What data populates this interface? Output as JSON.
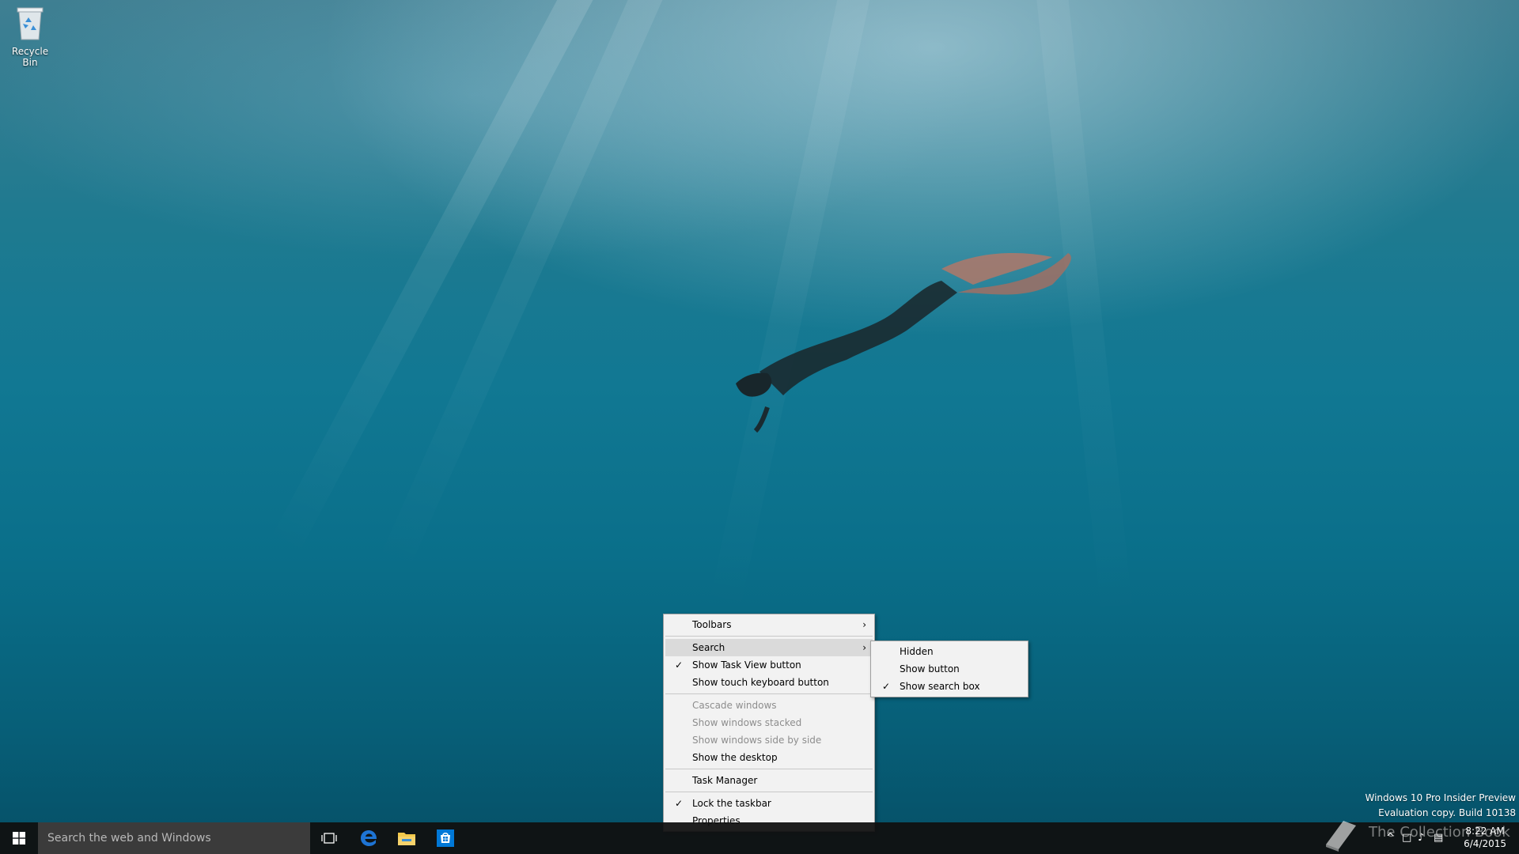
{
  "desktop": {
    "icons": [
      {
        "label": "Recycle Bin",
        "icon": "recycle-bin-icon"
      }
    ]
  },
  "context_menu": {
    "items": [
      {
        "label": "Toolbars",
        "checked": false,
        "submenu": true,
        "disabled": false
      },
      {
        "label": "Search",
        "checked": false,
        "submenu": true,
        "disabled": false,
        "highlighted": true
      },
      {
        "label": "Show Task View button",
        "checked": true,
        "submenu": false,
        "disabled": false
      },
      {
        "label": "Show touch keyboard button",
        "checked": false,
        "submenu": false,
        "disabled": false
      },
      {
        "label": "Cascade windows",
        "checked": false,
        "submenu": false,
        "disabled": true
      },
      {
        "label": "Show windows stacked",
        "checked": false,
        "submenu": false,
        "disabled": true
      },
      {
        "label": "Show windows side by side",
        "checked": false,
        "submenu": false,
        "disabled": true
      },
      {
        "label": "Show the desktop",
        "checked": false,
        "submenu": false,
        "disabled": false
      },
      {
        "label": "Task Manager",
        "checked": false,
        "submenu": false,
        "disabled": false
      },
      {
        "label": "Lock the taskbar",
        "checked": true,
        "submenu": false,
        "disabled": false
      },
      {
        "label": "Properties",
        "checked": false,
        "submenu": false,
        "disabled": false
      }
    ],
    "check_glyph": "✓",
    "arrow_glyph": "›"
  },
  "search_submenu": {
    "items": [
      {
        "label": "Hidden",
        "checked": false
      },
      {
        "label": "Show button",
        "checked": false
      },
      {
        "label": "Show search box",
        "checked": true
      }
    ]
  },
  "watermark": {
    "line1": "Windows 10 Pro Insider Preview",
    "line2": "Evaluation copy. Build 10138"
  },
  "brand_watermark": "The Collection Book",
  "taskbar": {
    "search_placeholder": "Search the web and Windows",
    "pinned": [
      "task-view-icon",
      "edge-icon",
      "file-explorer-icon",
      "store-icon"
    ],
    "clock_time": "8:22 AM",
    "clock_date": "6/4/2015",
    "tray_icons": [
      "chevron-up-icon",
      "network-icon",
      "volume-icon",
      "action-center-icon"
    ]
  },
  "colors": {
    "taskbar_bg": "#101010",
    "search_box_bg": "#3b3b3b",
    "menu_bg": "#f2f2f2",
    "menu_hover": "#dadada",
    "edge_blue": "#1e74d4",
    "store_blue": "#0078d7",
    "explorer_yellow": "#f2c94c"
  }
}
